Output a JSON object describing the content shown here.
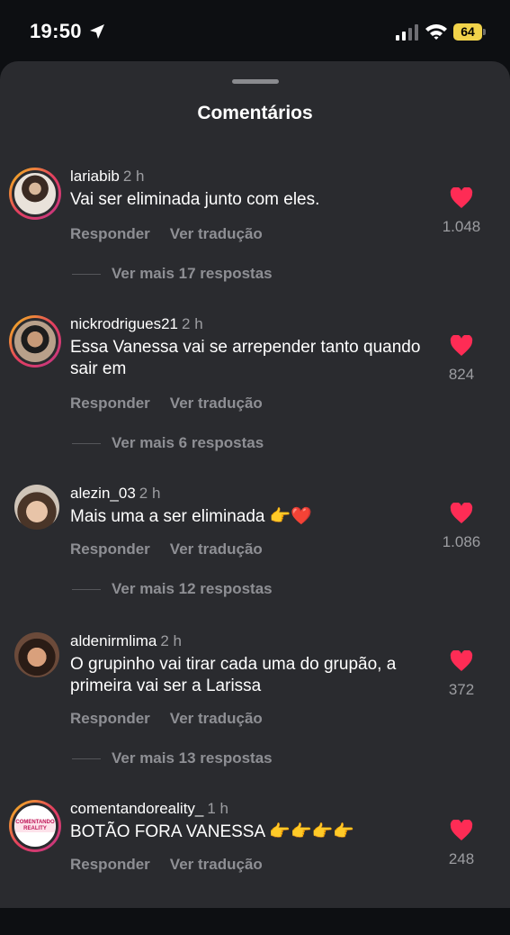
{
  "status_bar": {
    "time": "19:50",
    "battery": "64"
  },
  "sheet": {
    "title": "Comentários"
  },
  "actions": {
    "reply": "Responder",
    "translate": "Ver tradução"
  },
  "colors": {
    "heart": "#fe2c55",
    "background": "#2a2b2f"
  },
  "comments": [
    {
      "user": "lariabib",
      "ago": "2 h",
      "text": "Vai ser eliminada junto com eles.",
      "likes": "1.048",
      "more": "Ver mais 17 respostas"
    },
    {
      "user": "nickrodrigues21",
      "ago": "2 h",
      "text": "Essa Vanessa vai se arrepender tanto quando sair em",
      "likes": "824",
      "more": "Ver mais 6 respostas"
    },
    {
      "user": "alezin_03",
      "ago": "2 h",
      "text": "Mais uma a ser eliminada 👉❤️",
      "likes": "1.086",
      "more": "Ver mais 12 respostas"
    },
    {
      "user": "aldenirmlima",
      "ago": "2 h",
      "text": "O grupinho vai tirar cada uma do grupão, a primeira vai ser a Larissa",
      "likes": "372",
      "more": "Ver mais 13 respostas"
    },
    {
      "user": "comentandoreality_",
      "ago": "1 h",
      "text": "BOTÃO FORA VANESSA 👉👉👉👉",
      "likes": "248",
      "avatar_text": "COMENTANDO REALITY"
    }
  ]
}
